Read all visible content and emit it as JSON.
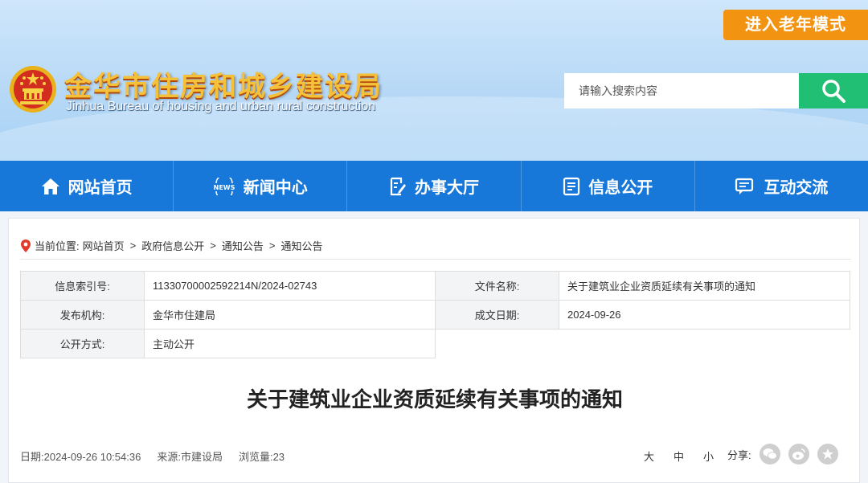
{
  "header": {
    "elder_mode": "进入老年模式",
    "title": "金华市住房和城乡建设局",
    "subtitle": "Jinhua Bureau of housing and urban rural construction",
    "search_placeholder": "请输入搜索内容"
  },
  "nav": {
    "items": [
      {
        "label": "网站首页",
        "icon": "home-icon"
      },
      {
        "label": "新闻中心",
        "icon": "news-icon",
        "badge": "NEWS"
      },
      {
        "label": "办事大厅",
        "icon": "edit-doc-icon"
      },
      {
        "label": "信息公开",
        "icon": "info-board-icon"
      },
      {
        "label": "互动交流",
        "icon": "chat-icon"
      }
    ]
  },
  "breadcrumb": {
    "prefix": "当前位置:",
    "items": [
      "网站首页",
      "政府信息公开",
      "通知公告",
      "通知公告"
    ],
    "separator": ">"
  },
  "meta_table": {
    "index_label": "信息索引号:",
    "index_value": "11330700002592214N/2024-02743",
    "file_label": "文件名称:",
    "file_value": "关于建筑业企业资质延续有关事项的通知",
    "publisher_label": "发布机构:",
    "publisher_value": "金华市住建局",
    "date_label": "成文日期:",
    "date_value": "2024-09-26",
    "open_label": "公开方式:",
    "open_value": "主动公开"
  },
  "article": {
    "title": "关于建筑业企业资质延续有关事项的通知",
    "date": "日期:2024-09-26 10:54:36",
    "source": "来源:市建设局",
    "views": "浏览量:23"
  },
  "font_size": {
    "large": "大",
    "medium": "中",
    "small": "小"
  },
  "share": {
    "label": "分享:",
    "icons": [
      "wechat-icon",
      "weibo-icon",
      "star-icon"
    ]
  },
  "colors": {
    "nav_blue": "#1878da",
    "search_green": "#21bf73",
    "elder_orange": "#f29312"
  }
}
